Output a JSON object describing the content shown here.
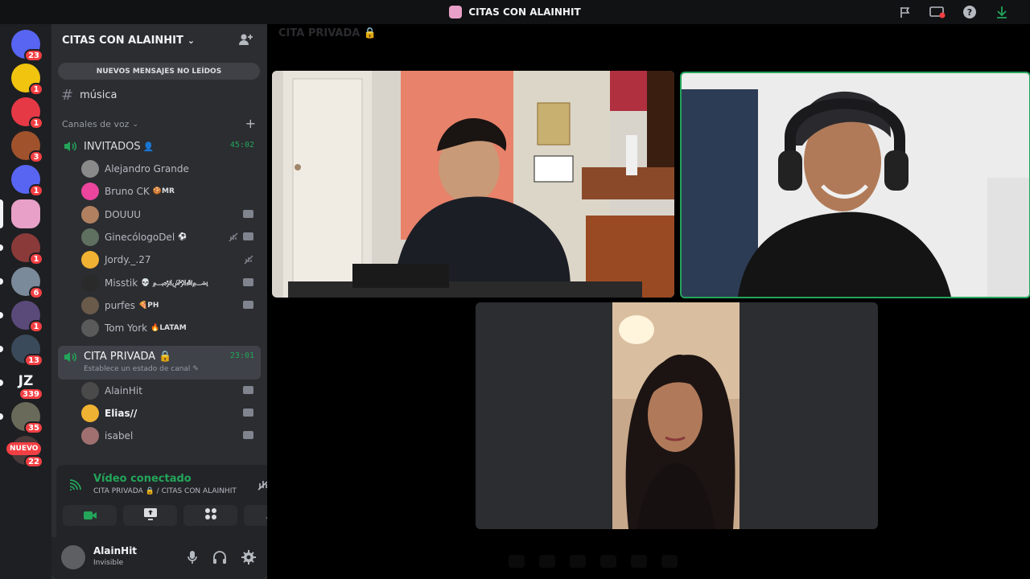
{
  "window": {
    "title": "CITAS CON ALAINHIT"
  },
  "titlebar_icons": [
    "flag-icon",
    "screen-share-icon",
    "help-icon",
    "download-icon"
  ],
  "guilds": [
    {
      "name": "guild-direct-messages",
      "badge": "23",
      "color": "#5865f2"
    },
    {
      "name": "guild-ecuador",
      "badge": "1",
      "color": "#f1c40f"
    },
    {
      "name": "guild-red-logo",
      "badge": "1",
      "color": "#e63946"
    },
    {
      "name": "guild-avatar-3",
      "badge": "3",
      "color": "#a0522d"
    },
    {
      "name": "guild-discord-blue",
      "badge": "1",
      "color": "#5865f2"
    },
    {
      "name": "guild-citas",
      "badge": "",
      "color": "#e8a0c8"
    },
    {
      "name": "guild-avatar-6",
      "badge": "1",
      "color": "#8b3a3a"
    },
    {
      "name": "guild-avatar-7",
      "badge": "6",
      "color": "#7a8a9a"
    },
    {
      "name": "guild-avatar-8",
      "badge": "1",
      "color": "#5a4a7a"
    },
    {
      "name": "guild-avatar-9",
      "badge": "13",
      "color": "#3a4a5a"
    },
    {
      "name": "guild-jz",
      "badge": "339",
      "color": "#1e1f22",
      "text": "JZ"
    },
    {
      "name": "guild-avatar-11",
      "badge": "35",
      "color": "#6a6a5a"
    },
    {
      "name": "guild-avatar-12",
      "badge": "22",
      "color": "#4a3a3a"
    }
  ],
  "guild_new_badge": "NUEVO",
  "server": {
    "name": "CITAS CON ALAINHIT"
  },
  "unread_banner": "NUEVOS MENSAJES NO LEÍDOS",
  "text_channel": {
    "name": "música"
  },
  "voice_category": "Canales de voz",
  "voice_channels": [
    {
      "name": "INVITADOS",
      "time": "45:02"
    },
    {
      "name": "CITA PRIVADA 🔒",
      "time": "23:01",
      "status": "Establece un estado de canal"
    }
  ],
  "invitados_users": [
    {
      "name": "Alejandro Grande",
      "tag": "",
      "color": "#8a8a8a"
    },
    {
      "name": "Bruno CK",
      "tag": "🍪MR",
      "color": "#eb459e"
    },
    {
      "name": "DOUUU",
      "tag": "",
      "color": "#b08060"
    },
    {
      "name": "GinecólogoDel",
      "tag": "⚽",
      "color": "#607060"
    },
    {
      "name": "Jordy._.27",
      "tag": "",
      "color": "#f0b232"
    },
    {
      "name": "Misstik",
      "tag": "💀 ﷽",
      "color": "#2a2a2a"
    },
    {
      "name": "purfes",
      "tag": "🍕PH",
      "color": "#6a5a4a"
    },
    {
      "name": "Tom York",
      "tag": "🔥LATAM",
      "color": "#5a5a5a"
    }
  ],
  "cita_users": [
    {
      "name": "AlainHit",
      "color": "#4a4a4a"
    },
    {
      "name": "Elias//",
      "color": "#f0b232"
    },
    {
      "name": "isabel",
      "color": "#a07070"
    }
  ],
  "voice_panel": {
    "title": "Vídeo conectado",
    "subtitle": "CITA PRIVADA 🔒 / CITAS CON ALAINHIT"
  },
  "user": {
    "name": "AlainHit",
    "status": "Invisible"
  },
  "main": {
    "channel_header": "CITA PRIVADA 🔒"
  },
  "colors": {
    "accent_green": "#23a55a",
    "danger_red": "#f23f43",
    "blurple": "#5865f2"
  }
}
